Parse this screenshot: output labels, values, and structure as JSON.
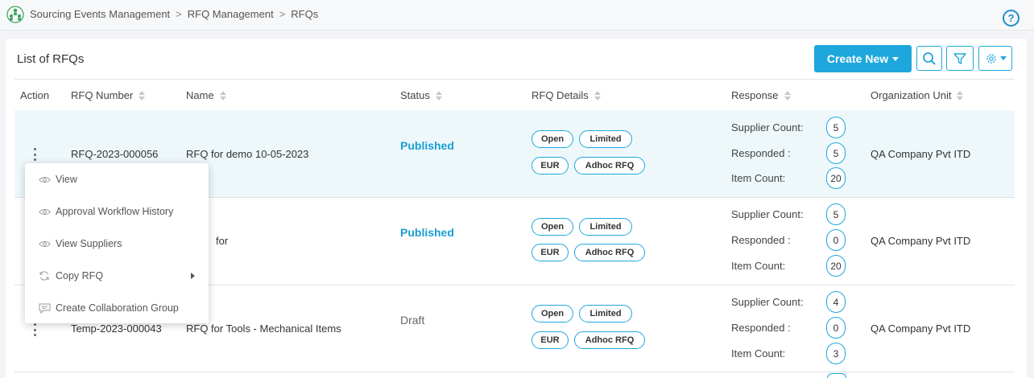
{
  "breadcrumb": {
    "items": [
      "Sourcing Events Management",
      "RFQ Management",
      "RFQs"
    ]
  },
  "list": {
    "title": "List of RFQs"
  },
  "toolbar": {
    "create_label": "Create New"
  },
  "colors": {
    "accent": "#1ea7dc",
    "published": "#1a9ed3",
    "row_highlight": "#eef8fb"
  },
  "icons": {
    "app": "people-network-icon",
    "help": "help-icon",
    "search": "search-icon",
    "filter": "filter-icon",
    "settings": "gear-icon",
    "kebab": "kebab-menu-icon",
    "view": "eye-icon",
    "copy": "refresh-icon",
    "collab": "chat-icon"
  },
  "help": {
    "glyph": "?"
  },
  "table": {
    "columns": [
      "Action",
      "RFQ Number",
      "Name",
      "Status",
      "RFQ Details",
      "Response",
      "Organization Unit"
    ],
    "response_labels": {
      "supplier": "Supplier Count:",
      "responded": "Responded :",
      "items": "Item Count:"
    },
    "rows": [
      {
        "number": "RFQ-2023-000056",
        "name": "RFQ for demo 10-05-2023",
        "status": "Published",
        "tags": [
          "Open",
          "Limited",
          "EUR",
          "Adhoc RFQ"
        ],
        "supplier_count": "5",
        "responded": "5",
        "item_count": "20",
        "org": "QA Company Pvt ITD"
      },
      {
        "number": "",
        "name": "for",
        "status": "Published",
        "tags": [
          "Open",
          "Limited",
          "EUR",
          "Adhoc RFQ"
        ],
        "supplier_count": "5",
        "responded": "0",
        "item_count": "20",
        "org": "QA Company Pvt ITD"
      },
      {
        "number": "Temp-2023-000043",
        "name": "RFQ for Tools - Mechanical Items",
        "status": "Draft",
        "tags": [
          "Open",
          "Limited",
          "EUR",
          "Adhoc RFQ"
        ],
        "supplier_count": "4",
        "responded": "0",
        "item_count": "3",
        "org": "QA Company Pvt ITD"
      }
    ]
  },
  "action_menu": {
    "items": [
      "View",
      "Approval Workflow History",
      "View Suppliers",
      "Copy RFQ",
      "Create Collaboration Group"
    ]
  }
}
